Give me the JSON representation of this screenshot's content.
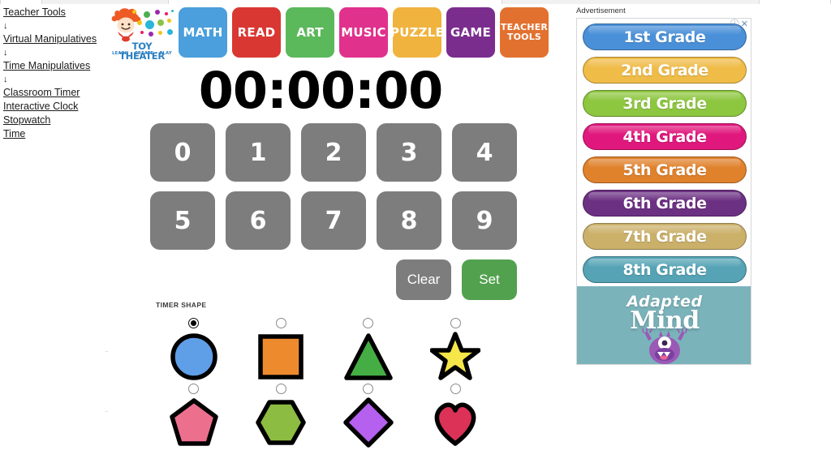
{
  "page": {
    "title": "Classroom Timer"
  },
  "sidebar": {
    "items": [
      {
        "label": "Teacher Tools",
        "type": "link",
        "wrap": false
      },
      {
        "label": "↓",
        "type": "arrow"
      },
      {
        "label": "Virtual Manipulatives",
        "type": "link",
        "wrap": true
      },
      {
        "label": "↓",
        "type": "arrow"
      },
      {
        "label": "Time Manipulatives",
        "type": "link",
        "wrap": false
      },
      {
        "label": "↓",
        "type": "arrow"
      },
      {
        "label": "Classroom Timer",
        "type": "link",
        "wrap": false
      },
      {
        "label": "Interactive Clock",
        "type": "link",
        "wrap": false
      },
      {
        "label": "Stopwatch",
        "type": "link",
        "wrap": false
      },
      {
        "label": "Time",
        "type": "link",
        "wrap": false
      }
    ]
  },
  "logo": {
    "name": "TOY THEATER",
    "tagline": "LEARN • CREATE • PLAY",
    "icon": "jester-logo-icon"
  },
  "nav": {
    "items": [
      {
        "label": "MATH",
        "color": "#4a9fdc",
        "icon": "nav-math",
        "small": false
      },
      {
        "label": "READ",
        "color": "#d93832",
        "icon": "nav-read",
        "small": false
      },
      {
        "label": "ART",
        "color": "#5bb85b",
        "icon": "nav-art",
        "small": false
      },
      {
        "label": "MUSIC",
        "color": "#e0318d",
        "icon": "nav-music",
        "small": false
      },
      {
        "label": "PUZZLE",
        "color": "#f0b33e",
        "icon": "nav-puzzle",
        "small": false
      },
      {
        "label": "GAME",
        "color": "#7b2d8e",
        "icon": "nav-game",
        "small": false
      },
      {
        "label": "TEACHER TOOLS",
        "color": "#e2712f",
        "icon": "nav-teacher",
        "small": true
      }
    ]
  },
  "timer": {
    "display": "00:00:00",
    "hours": "00",
    "minutes": "00",
    "seconds": "00"
  },
  "keypad": {
    "row1": [
      "0",
      "1",
      "2",
      "3",
      "4"
    ],
    "row2": [
      "5",
      "6",
      "7",
      "8",
      "9"
    ],
    "key_color": "#7d7d7d",
    "clear_label": "Clear",
    "clear_color": "#7d7d7d",
    "set_label": "Set",
    "set_color": "#52a14e"
  },
  "shapes": {
    "section_label": "TIMER SHAPE",
    "selected_index": 0,
    "items": [
      {
        "name": "circle",
        "icon": "circle-shape-icon",
        "fill": "#5f9fe8"
      },
      {
        "name": "square",
        "icon": "square-shape-icon",
        "fill": "#ee8a2e"
      },
      {
        "name": "triangle",
        "icon": "triangle-shape-icon",
        "fill": "#44ae45"
      },
      {
        "name": "star",
        "icon": "star-shape-icon",
        "fill": "#f5e64a"
      },
      {
        "name": "pentagon",
        "icon": "pentagon-shape-icon",
        "fill": "#ec6f8e"
      },
      {
        "name": "hexagon",
        "icon": "hexagon-shape-icon",
        "fill": "#8cbc41"
      },
      {
        "name": "diamond",
        "icon": "diamond-shape-icon",
        "fill": "#b560ee"
      },
      {
        "name": "heart",
        "icon": "heart-shape-icon",
        "fill": "#dc3257"
      }
    ]
  },
  "advertisement": {
    "label": "Advertisement",
    "info_icon": "ⓘ",
    "close_icon": "✕",
    "grades": [
      {
        "label": "1st Grade",
        "color": "#4a90d9"
      },
      {
        "label": "2nd Grade",
        "color": "#f0bc48"
      },
      {
        "label": "3rd Grade",
        "color": "#8dc63f"
      },
      {
        "label": "4th Grade",
        "color": "#e0187d"
      },
      {
        "label": "5th Grade",
        "color": "#e0812c"
      },
      {
        "label": "6th Grade",
        "color": "#6c3083"
      },
      {
        "label": "7th Grade",
        "color": "#cbb06a"
      },
      {
        "label": "8th Grade",
        "color": "#55a3b5"
      }
    ],
    "brand_line1": "Adapted",
    "brand_line2": "Mind",
    "brand_bg": "#7bb3bb",
    "mascot_icon": "purple-monster-icon"
  }
}
